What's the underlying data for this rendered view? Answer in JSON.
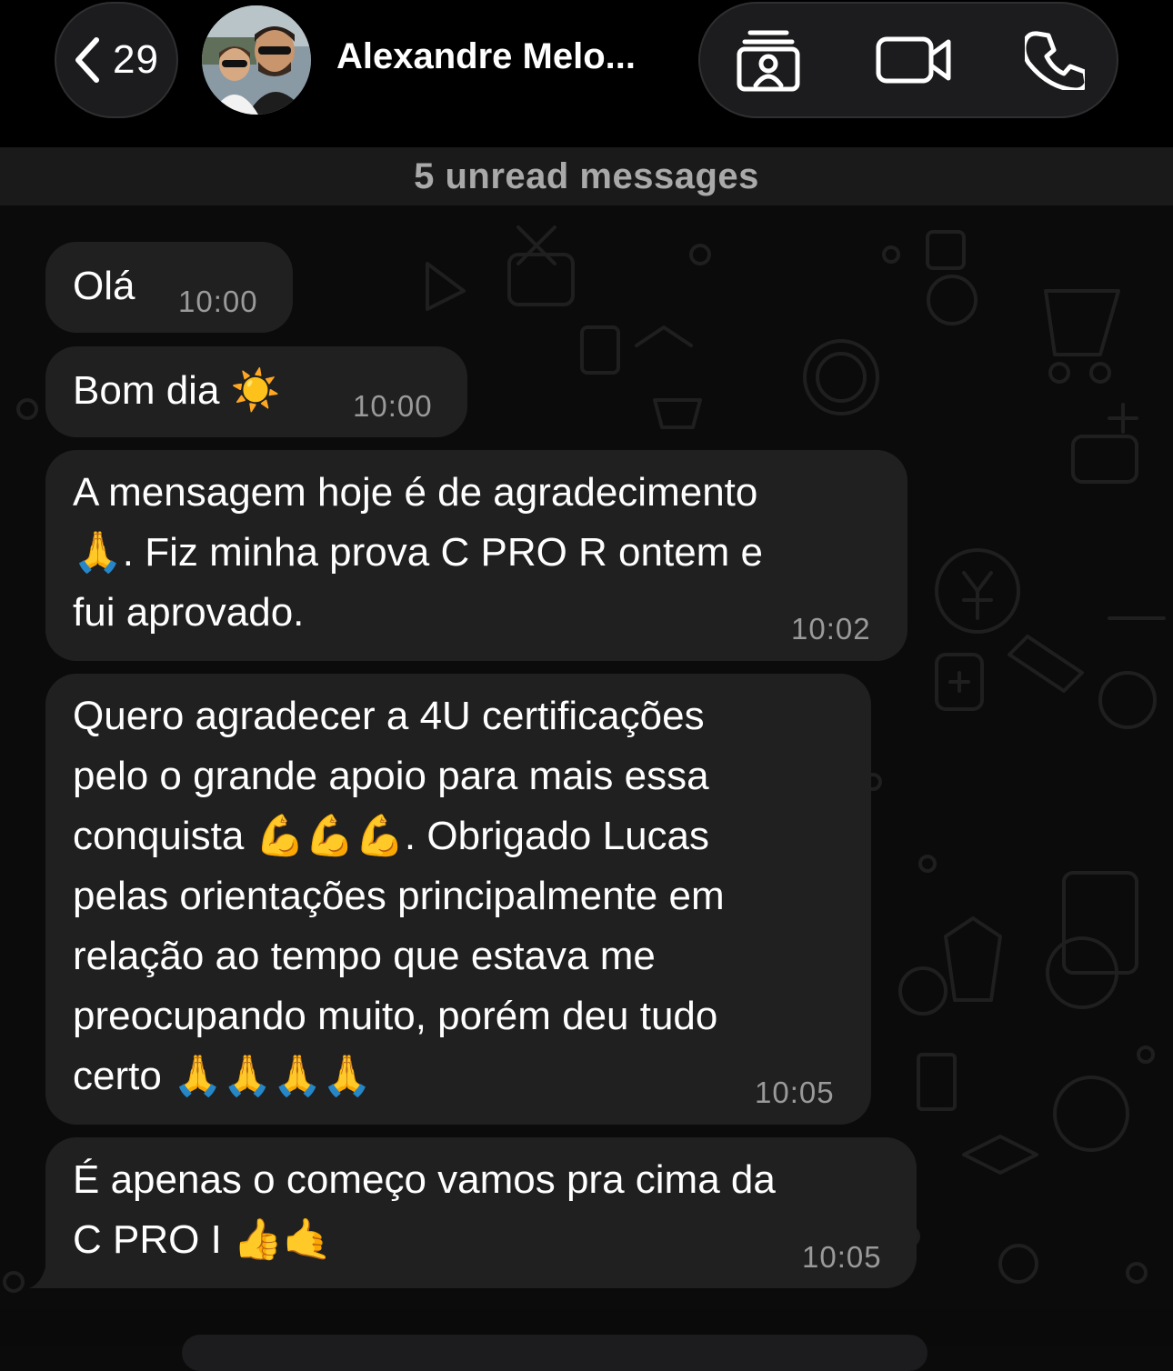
{
  "header": {
    "back_count": "29",
    "contact_name": "Alexandre Melo...",
    "icons": [
      "back-chevron-icon",
      "contact-card-icon",
      "video-camera-icon",
      "phone-icon"
    ]
  },
  "unread_banner": "5 unread messages",
  "messages": [
    {
      "lines": [
        "Olá"
      ],
      "time": "10:00"
    },
    {
      "lines": [
        "Bom dia ☀️"
      ],
      "time": "10:00"
    },
    {
      "lines": [
        "A mensagem hoje é de agradecimento",
        "🙏. Fiz minha prova C PRO R ontem e",
        "fui aprovado."
      ],
      "time": "10:02"
    },
    {
      "lines": [
        "Quero agradecer a 4U certificações",
        "pelo o grande apoio para mais essa",
        "conquista 💪💪💪. Obrigado Lucas",
        "pelas orientações principalmente em",
        "relação ao tempo que estava me",
        "preocupando muito, porém deu tudo",
        "certo 🙏🙏🙏🙏"
      ],
      "time": "10:05"
    },
    {
      "lines": [
        "É apenas o começo vamos pra cima da",
        "C PRO I 👍🤙"
      ],
      "time": "10:05"
    }
  ],
  "colors": {
    "background": "#0b0b0b",
    "bubble": "#202020",
    "header": "#000000",
    "timestamp": "#9a9a9a",
    "banner_text": "#a9a9a9"
  }
}
